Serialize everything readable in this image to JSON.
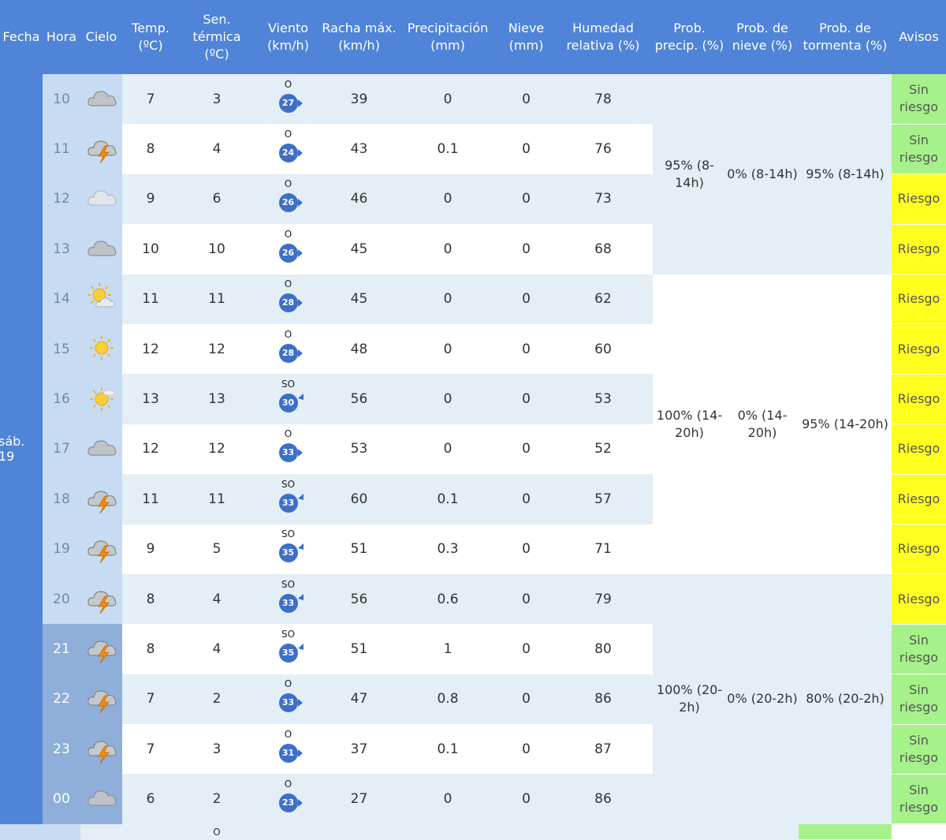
{
  "colors": {
    "header_bg": "#4f84d8",
    "row_light": "#e3eef6",
    "row_white": "#ffffff",
    "hour_col": "#c7dcf3",
    "hour_col_night": "#8fafda",
    "wind_circle": "#3d6fc7",
    "avisos_sin_riesgo": "#a6f28a",
    "avisos_riesgo": "#ffff1e"
  },
  "headers": {
    "fecha": "Fecha",
    "hora": "Hora",
    "cielo": "Cielo",
    "temp": "Temp.\n(ºC)",
    "sensacion": "Sen.\ntérmica\n(ºC)",
    "viento": "Viento\n(km/h)",
    "racha": "Racha máx.\n(km/h)",
    "precip": "Precipitación\n(mm)",
    "nieve": "Nieve\n(mm)",
    "humedad": "Humedad\nrelativa (%)",
    "prob_precip": "Prob.\nprecip. (%)",
    "prob_nieve": "Prob. de\nnieve (%)",
    "prob_tormenta": "Prob. de\ntormenta (%)",
    "avisos": "Avisos"
  },
  "fecha": "sáb. 19",
  "rows": [
    {
      "hora": "10",
      "sky": "cloudy-icon",
      "temp": "7",
      "sens": "3",
      "wind_dir": "O",
      "wind_speed": "27",
      "racha": "39",
      "precip": "0",
      "nieve": "0",
      "humedad": "78",
      "aviso": "Sin\nriesgo",
      "aviso_level": "sin"
    },
    {
      "hora": "11",
      "sky": "thunderstorm-icon",
      "temp": "8",
      "sens": "4",
      "wind_dir": "O",
      "wind_speed": "24",
      "racha": "43",
      "precip": "0.1",
      "nieve": "0",
      "humedad": "76",
      "aviso": "Sin\nriesgo",
      "aviso_level": "sin"
    },
    {
      "hora": "12",
      "sky": "cloud-light-icon",
      "temp": "9",
      "sens": "6",
      "wind_dir": "O",
      "wind_speed": "26",
      "racha": "46",
      "precip": "0",
      "nieve": "0",
      "humedad": "73",
      "aviso": "Riesgo",
      "aviso_level": "riesgo"
    },
    {
      "hora": "13",
      "sky": "cloudy-icon",
      "temp": "10",
      "sens": "10",
      "wind_dir": "O",
      "wind_speed": "26",
      "racha": "45",
      "precip": "0",
      "nieve": "0",
      "humedad": "68",
      "aviso": "Riesgo",
      "aviso_level": "riesgo"
    },
    {
      "hora": "14",
      "sky": "sun-cloud-icon",
      "temp": "11",
      "sens": "11",
      "wind_dir": "O",
      "wind_speed": "28",
      "racha": "45",
      "precip": "0",
      "nieve": "0",
      "humedad": "62",
      "aviso": "Riesgo",
      "aviso_level": "riesgo"
    },
    {
      "hora": "15",
      "sky": "sun-icon",
      "temp": "12",
      "sens": "12",
      "wind_dir": "O",
      "wind_speed": "28",
      "racha": "48",
      "precip": "0",
      "nieve": "0",
      "humedad": "60",
      "aviso": "Riesgo",
      "aviso_level": "riesgo"
    },
    {
      "hora": "16",
      "sky": "sun-haze-icon",
      "temp": "13",
      "sens": "13",
      "wind_dir": "SO",
      "wind_speed": "30",
      "racha": "56",
      "precip": "0",
      "nieve": "0",
      "humedad": "53",
      "aviso": "Riesgo",
      "aviso_level": "riesgo"
    },
    {
      "hora": "17",
      "sky": "cloudy-icon",
      "temp": "12",
      "sens": "12",
      "wind_dir": "O",
      "wind_speed": "33",
      "racha": "53",
      "precip": "0",
      "nieve": "0",
      "humedad": "52",
      "aviso": "Riesgo",
      "aviso_level": "riesgo"
    },
    {
      "hora": "18",
      "sky": "thunderstorm-icon",
      "temp": "11",
      "sens": "11",
      "wind_dir": "SO",
      "wind_speed": "33",
      "racha": "60",
      "precip": "0.1",
      "nieve": "0",
      "humedad": "57",
      "aviso": "Riesgo",
      "aviso_level": "riesgo"
    },
    {
      "hora": "19",
      "sky": "thunderstorm-icon",
      "temp": "9",
      "sens": "5",
      "wind_dir": "SO",
      "wind_speed": "35",
      "racha": "51",
      "precip": "0.3",
      "nieve": "0",
      "humedad": "71",
      "aviso": "Riesgo",
      "aviso_level": "riesgo"
    },
    {
      "hora": "20",
      "sky": "thunderstorm-icon",
      "temp": "8",
      "sens": "4",
      "wind_dir": "SO",
      "wind_speed": "33",
      "racha": "56",
      "precip": "0.6",
      "nieve": "0",
      "humedad": "79",
      "aviso": "Riesgo",
      "aviso_level": "riesgo"
    },
    {
      "hora": "21",
      "sky": "thunderstorm-icon",
      "temp": "8",
      "sens": "4",
      "wind_dir": "SO",
      "wind_speed": "35",
      "racha": "51",
      "precip": "1",
      "nieve": "0",
      "humedad": "80",
      "aviso": "Sin\nriesgo",
      "aviso_level": "sin",
      "night": true
    },
    {
      "hora": "22",
      "sky": "thunderstorm-icon",
      "temp": "7",
      "sens": "2",
      "wind_dir": "O",
      "wind_speed": "33",
      "racha": "47",
      "precip": "0.8",
      "nieve": "0",
      "humedad": "86",
      "aviso": "Sin\nriesgo",
      "aviso_level": "sin",
      "night": true
    },
    {
      "hora": "23",
      "sky": "thunderstorm-icon",
      "temp": "7",
      "sens": "3",
      "wind_dir": "O",
      "wind_speed": "31",
      "racha": "37",
      "precip": "0.1",
      "nieve": "0",
      "humedad": "87",
      "aviso": "Sin\nriesgo",
      "aviso_level": "sin",
      "night": true
    },
    {
      "hora": "00",
      "sky": "cloudy-icon",
      "temp": "6",
      "sens": "2",
      "wind_dir": "O",
      "wind_speed": "23",
      "racha": "27",
      "precip": "0",
      "nieve": "0",
      "humedad": "86",
      "aviso": "Sin\nriesgo",
      "aviso_level": "sin",
      "night": true
    }
  ],
  "periods": [
    {
      "rows": 4,
      "prob_precip": "95% (8-\n14h)",
      "prob_nieve": "0% (8-14h)",
      "prob_tormenta": "95% (8-14h)"
    },
    {
      "rows": 6,
      "prob_precip": "100% (14-\n20h)",
      "prob_nieve": "0% (14-\n20h)",
      "prob_tormenta": "95% (14-20h)"
    },
    {
      "rows": 5,
      "prob_precip": "100% (20-\n2h)",
      "prob_nieve": "0% (20-2h)",
      "prob_tormenta": "80% (20-2h)"
    }
  ],
  "extra_row": {
    "wind_dir": "O"
  }
}
